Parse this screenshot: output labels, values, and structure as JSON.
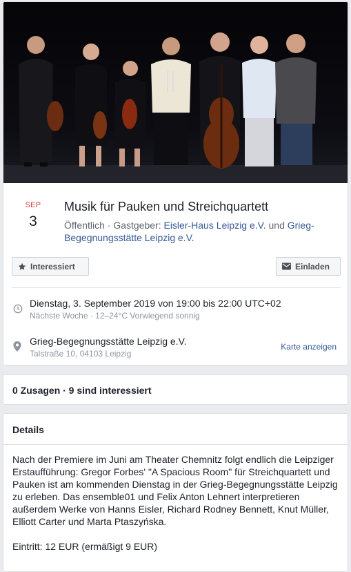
{
  "event": {
    "date_month": "SEP",
    "date_day": "3",
    "title": "Musik für Pauken und Streichquartett",
    "visibility": "Öffentlich",
    "host_prefix": " · Gastgeber: ",
    "host_1": "Eisler-Haus Leipzig e.V.",
    "host_joiner": " und ",
    "host_2": "Grieg-Begegnungsstätte Leipzig e.V."
  },
  "actions": {
    "interested_label": "Interessiert",
    "invite_label": "Einladen"
  },
  "time": {
    "main": "Dienstag, 3. September 2019 von 19:00 bis 22:00 UTC+02",
    "sub": "Nächste Woche · 12–24°C Vorwiegend sonnig"
  },
  "location": {
    "name": "Grieg-Begegnungsstätte Leipzig e.V.",
    "address": "Talstraße 10, 04103 Leipzig",
    "map_link": "Karte anzeigen"
  },
  "attendance": {
    "text": "0 Zusagen · 9 sind interessiert"
  },
  "details": {
    "heading": "Details",
    "paragraph_1": "Nach der Premiere im Juni am Theater Chemnitz folgt endlich die Leipziger Erstaufführung: Gregor Forbes' \"A Spacious Room\" für Streichquartett und Pauken ist am kommenden Dienstag in der Grieg-Begegnungsstätte Leipzig zu erleben. Das ensemble01 und Felix Anton Lehnert interpretieren außerdem Werke von Hanns Eisler, Richard Rodney Bennett, Knut Müller, Elliott Carter und Marta Ptaszyńska.",
    "paragraph_2": "Eintritt: 12 EUR (ermäßigt 9 EUR)"
  },
  "icons": {
    "star": "star-icon",
    "envelope": "envelope-icon",
    "clock": "clock-icon",
    "pin": "map-pin-icon"
  },
  "colors": {
    "month_red": "#e03c3c",
    "link_blue": "#365899",
    "page_bg": "#e9ebee"
  }
}
